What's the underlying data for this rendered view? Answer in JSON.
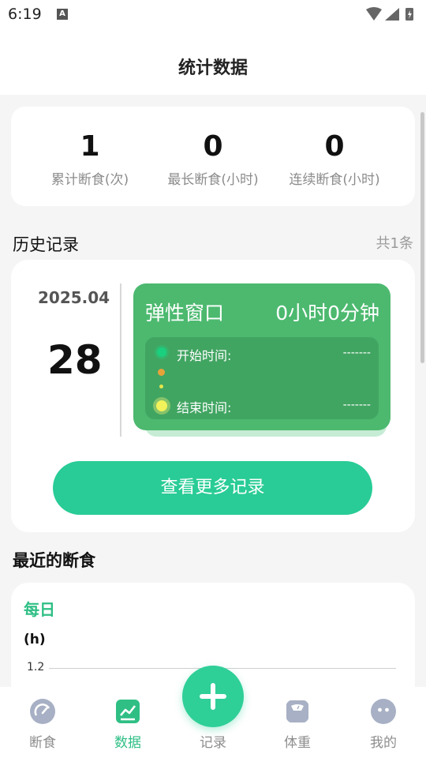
{
  "status_bar": {
    "time": "6:19",
    "notification_letter": "A"
  },
  "header": {
    "title": "统计数据"
  },
  "summary": {
    "stats": [
      {
        "value": "1",
        "label": "累计断食(次)"
      },
      {
        "value": "0",
        "label": "最长断食(小时)"
      },
      {
        "value": "0",
        "label": "连续断食(小时)"
      }
    ]
  },
  "history": {
    "title": "历史记录",
    "count": "共1条",
    "record": {
      "month": "2025.04",
      "day": "28",
      "plan": "弹性窗口",
      "duration": "0小时0分钟",
      "start_label": "开始时间:",
      "start_value": "-------",
      "end_label": "结束时间:",
      "end_value": "-------"
    },
    "more_button": "查看更多记录"
  },
  "recent": {
    "title": "最近的断食",
    "tab": "每日",
    "unit": "(h)",
    "chart_data": {
      "type": "bar",
      "ylabel": "(h)",
      "yticks_visible": [
        1.2
      ]
    }
  },
  "colors": {
    "accent": "#2fbf85",
    "card_green": "#4cb96f",
    "button": "#29cc96"
  },
  "tabbar": {
    "items": [
      {
        "label": "断食",
        "icon": "gauge-icon"
      },
      {
        "label": "数据",
        "icon": "chart-icon"
      },
      {
        "label": "记录",
        "icon": "plus-icon"
      },
      {
        "label": "体重",
        "icon": "scale-icon"
      },
      {
        "label": "我的",
        "icon": "face-icon"
      }
    ]
  }
}
